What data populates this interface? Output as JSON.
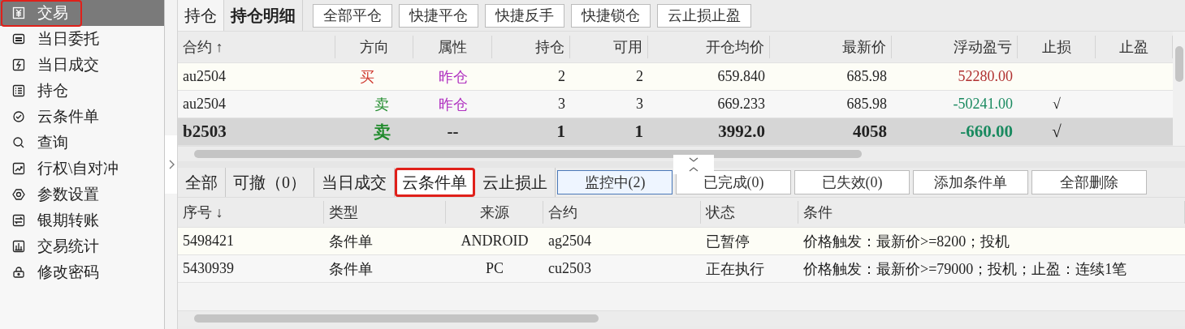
{
  "sidebar": {
    "items": [
      {
        "label": "交易",
        "selected": true,
        "highlighted": true
      },
      {
        "label": "当日委托",
        "selected": false,
        "highlighted": false
      },
      {
        "label": "当日成交",
        "selected": false,
        "highlighted": false
      },
      {
        "label": "持仓",
        "selected": false,
        "highlighted": false
      },
      {
        "label": "云条件单",
        "selected": false,
        "highlighted": false
      },
      {
        "label": "查询",
        "selected": false,
        "highlighted": false
      },
      {
        "label": "行权\\自对冲",
        "selected": false,
        "highlighted": false
      },
      {
        "label": "参数设置",
        "selected": false,
        "highlighted": false
      },
      {
        "label": "银期转账",
        "selected": false,
        "highlighted": false
      },
      {
        "label": "交易统计",
        "selected": false,
        "highlighted": false
      },
      {
        "label": "修改密码",
        "selected": false,
        "highlighted": false
      }
    ]
  },
  "positions": {
    "tabs": [
      {
        "label": "持仓",
        "selected": true
      },
      {
        "label": "持仓明细",
        "selected": false
      }
    ],
    "buttons": [
      "全部平仓",
      "快捷平仓",
      "快捷反手",
      "快捷锁仓",
      "云止损止盈"
    ],
    "columns": [
      "合约 ↑",
      "方向",
      "属性",
      "持仓",
      "可用",
      "开仓均价",
      "最新价",
      "浮动盈亏",
      "止损",
      "止盈"
    ],
    "rows": [
      {
        "contract": "au2504",
        "direction": {
          "text": "买",
          "kind": "buy"
        },
        "attribute": {
          "text": "昨仓",
          "kind": "yesterday"
        },
        "holding": "2",
        "available": "2",
        "open_avg": "659.840",
        "last": "685.98",
        "pnl": {
          "text": "52280.00",
          "kind": "profit"
        },
        "selected": false
      },
      {
        "contract": "au2504",
        "direction": {
          "text": "卖",
          "kind": "sell"
        },
        "attribute": {
          "text": "昨仓",
          "kind": "yesterday"
        },
        "holding": "3",
        "available": "3",
        "open_avg": "669.233",
        "last": "685.98",
        "pnl": {
          "text": "-50241.00",
          "kind": "loss"
        },
        "stop_loss": "√",
        "selected": false
      },
      {
        "contract": "b2503",
        "direction": {
          "text": "卖",
          "kind": "sell"
        },
        "attribute": {
          "text": "--",
          "kind": "none"
        },
        "holding": "1",
        "available": "1",
        "open_avg": "3992.0",
        "last": "4058",
        "pnl": {
          "text": "-660.00",
          "kind": "loss"
        },
        "stop_loss": "√",
        "selected": true
      }
    ]
  },
  "orders": {
    "tabs": [
      {
        "label": "全部",
        "selected": false,
        "highlighted": false
      },
      {
        "label": "可撤（0）",
        "selected": false,
        "highlighted": false
      },
      {
        "label": "当日成交",
        "selected": false,
        "highlighted": false
      },
      {
        "label": "云条件单",
        "selected": true,
        "highlighted": true
      },
      {
        "label": "云止损止",
        "selected": false,
        "highlighted": false
      }
    ],
    "filters": [
      {
        "label": "监控中(2)",
        "selected": true
      },
      {
        "label": "已完成(0)",
        "selected": false
      },
      {
        "label": "已失效(0)",
        "selected": false
      }
    ],
    "buttons": [
      "添加条件单",
      "全部删除"
    ],
    "columns": [
      "序号 ↓",
      "类型",
      "来源",
      "合约",
      "状态",
      "条件"
    ],
    "rows": [
      {
        "id": "5498421",
        "type": "条件单",
        "source": "ANDROID",
        "contract": "ag2504",
        "status": "已暂停",
        "condition": "价格触发：最新价>=8200；投机"
      },
      {
        "id": "5430939",
        "type": "条件单",
        "source": "PC",
        "contract": "cu2503",
        "status": "正在执行",
        "condition": "价格触发：最新价>=79000；投机；止盈：连续1笔"
      }
    ]
  }
}
